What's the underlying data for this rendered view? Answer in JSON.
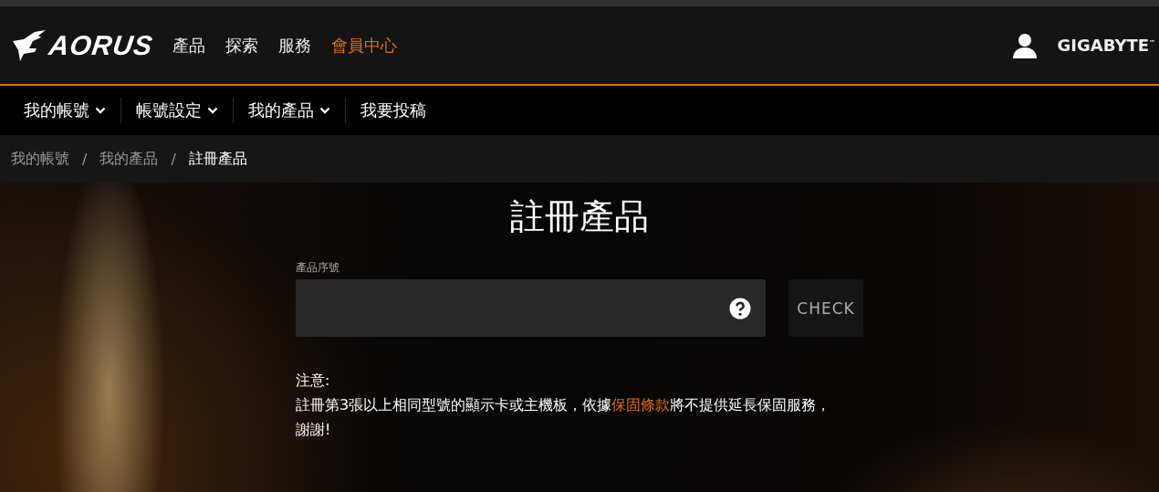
{
  "header": {
    "logo": "AORUS",
    "nav": [
      {
        "label": "產品",
        "selected": false
      },
      {
        "label": "探索",
        "selected": false
      },
      {
        "label": "服務",
        "selected": false
      },
      {
        "label": "會員中心",
        "selected": true
      }
    ],
    "brand": "GIGABYTE",
    "brand_mark": "™"
  },
  "subnav": [
    {
      "label": "我的帳號",
      "kind": "dropdown"
    },
    {
      "label": "帳號設定",
      "kind": "dropdown"
    },
    {
      "label": "我的產品",
      "kind": "dropdown"
    },
    {
      "label": "我要投稿",
      "kind": "link"
    }
  ],
  "breadcrumb": [
    {
      "label": "我的帳號",
      "current": false
    },
    {
      "label": "我的產品",
      "current": false
    },
    {
      "label": "註冊產品",
      "current": true
    }
  ],
  "breadcrumb_separator": "/",
  "page_title": "註冊產品",
  "serial_field": {
    "label": "產品序號"
  },
  "check_button": "CHECK",
  "notice": {
    "heading": "注意:",
    "before": "註冊第3張以上相同型號的顯示卡或主機板，依據",
    "link": "保固條款",
    "after": "將不提供延長保固服務，謝謝!"
  }
}
